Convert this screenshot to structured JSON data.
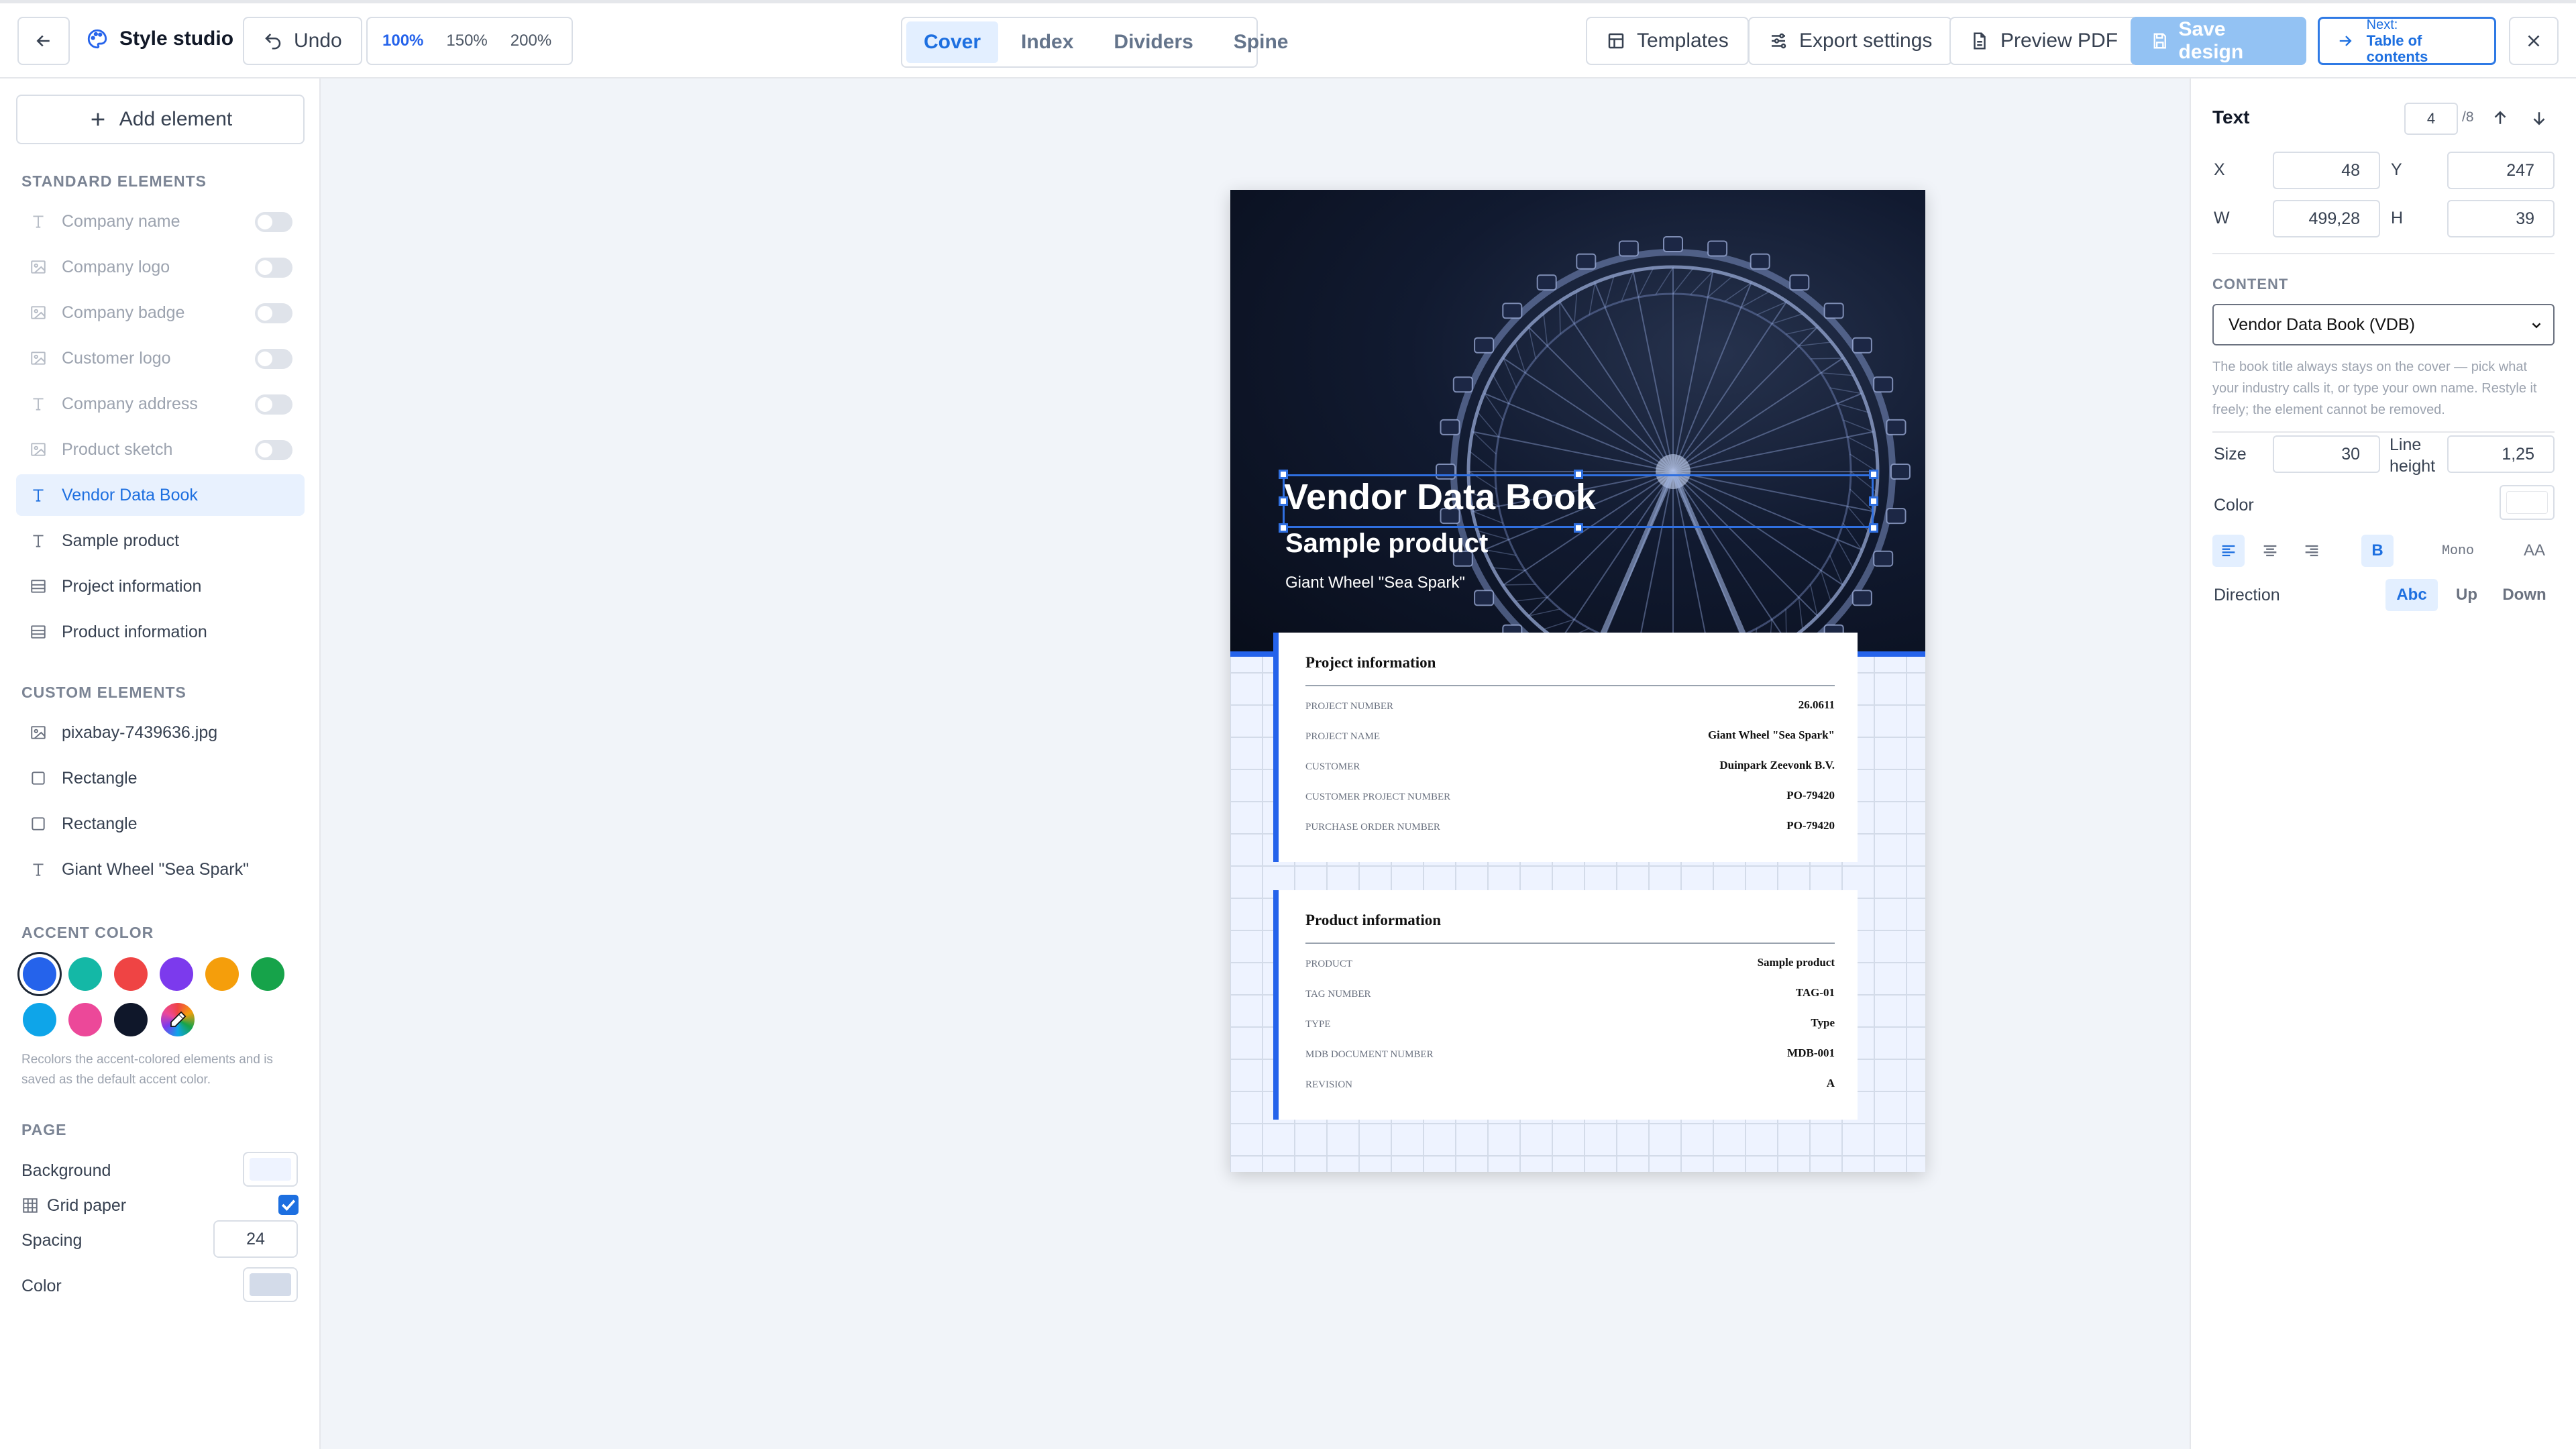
{
  "topbar": {
    "brand": "Style studio",
    "undo": "Undo",
    "zoom": [
      "100%",
      "150%",
      "200%"
    ],
    "zoom_selected": "100%",
    "view_tabs": [
      "Cover",
      "Index",
      "Dividers",
      "Spine"
    ],
    "view_selected": "Cover",
    "templates": "Templates",
    "export_settings": "Export settings",
    "preview_pdf": "Preview PDF",
    "save_design": "Save design",
    "next_label": "Next:",
    "next_target": "Table of contents"
  },
  "sidebar": {
    "add_element": "Add element",
    "standard_heading": "STANDARD ELEMENTS",
    "standard_items": [
      {
        "label": "Company name",
        "icon": "text-icon",
        "enabled": false
      },
      {
        "label": "Company logo",
        "icon": "image-icon",
        "enabled": false
      },
      {
        "label": "Company badge",
        "icon": "image-icon",
        "enabled": false
      },
      {
        "label": "Customer logo",
        "icon": "image-icon",
        "enabled": false
      },
      {
        "label": "Company address",
        "icon": "text-icon",
        "enabled": false
      },
      {
        "label": "Product sketch",
        "icon": "image-icon",
        "enabled": false
      },
      {
        "label": "Vendor Data Book",
        "icon": "text-icon",
        "selected": true
      },
      {
        "label": "Sample product",
        "icon": "text-icon"
      },
      {
        "label": "Project information",
        "icon": "table-icon"
      },
      {
        "label": "Product information",
        "icon": "table-icon"
      }
    ],
    "custom_heading": "CUSTOM ELEMENTS",
    "custom_items": [
      {
        "label": "pixabay-7439636.jpg",
        "icon": "image-icon"
      },
      {
        "label": "Rectangle",
        "icon": "square-icon"
      },
      {
        "label": "Rectangle",
        "icon": "square-icon"
      },
      {
        "label": "Giant Wheel \"Sea Spark\"",
        "icon": "text-icon"
      }
    ],
    "accent_heading": "ACCENT COLOR",
    "accent_colors": [
      "#2563eb",
      "#14b8a6",
      "#ef4444",
      "#7c3aed",
      "#f59e0b",
      "#16a34a",
      "#0ea5e9",
      "#ec4899",
      "#0f172a"
    ],
    "accent_selected": "#2563eb",
    "accent_hint": "Recolors the accent-colored elements and is saved as the default accent color.",
    "page_heading": "PAGE",
    "background_label": "Background",
    "background_color": "#eef3ff",
    "grid_label": "Grid paper",
    "grid_checked": true,
    "spacing_label": "Spacing",
    "spacing_value": "24",
    "color_label": "Color",
    "grid_color": "#d3dbe9"
  },
  "cover": {
    "title": "Vendor Data Book",
    "subtitle": "Sample product",
    "small_text": "Giant Wheel \"Sea Spark\"",
    "accent": "#2563eb",
    "project": {
      "heading": "Project information",
      "rows": [
        {
          "k": "PROJECT NUMBER",
          "v": "26.0611"
        },
        {
          "k": "PROJECT NAME",
          "v": "Giant Wheel \"Sea Spark\""
        },
        {
          "k": "CUSTOMER",
          "v": "Duinpark Zeevonk B.V."
        },
        {
          "k": "CUSTOMER PROJECT NUMBER",
          "v": "PO-79420"
        },
        {
          "k": "PURCHASE ORDER NUMBER",
          "v": "PO-79420"
        }
      ]
    },
    "product": {
      "heading": "Product information",
      "rows": [
        {
          "k": "PRODUCT",
          "v": "Sample product"
        },
        {
          "k": "TAG NUMBER",
          "v": "TAG-01"
        },
        {
          "k": "TYPE",
          "v": "Type"
        },
        {
          "k": "MDB DOCUMENT NUMBER",
          "v": "MDB-001"
        },
        {
          "k": "REVISION",
          "v": "A"
        }
      ]
    }
  },
  "inspector": {
    "title": "Text",
    "layer_index": "4",
    "layer_total": "/8",
    "x_label": "X",
    "x": "48",
    "y_label": "Y",
    "y": "247",
    "w_label": "W",
    "w": "499,28",
    "h_label": "H",
    "h": "39",
    "content_heading": "CONTENT",
    "content_value": "Vendor Data Book (VDB)",
    "content_hint": "The book title always stays on the cover — pick what your industry calls it, or type your own name. Restyle it freely; the element cannot be removed.",
    "size_label": "Size",
    "size": "30",
    "line_height_label": "Line height",
    "line_height": "1,25",
    "color_label": "Color",
    "color": "#ffffff",
    "bold": "B",
    "mono": "Mono",
    "caps": "AA",
    "direction_label": "Direction",
    "directions": [
      "Abc",
      "Up",
      "Down"
    ],
    "direction_selected": "Abc"
  }
}
